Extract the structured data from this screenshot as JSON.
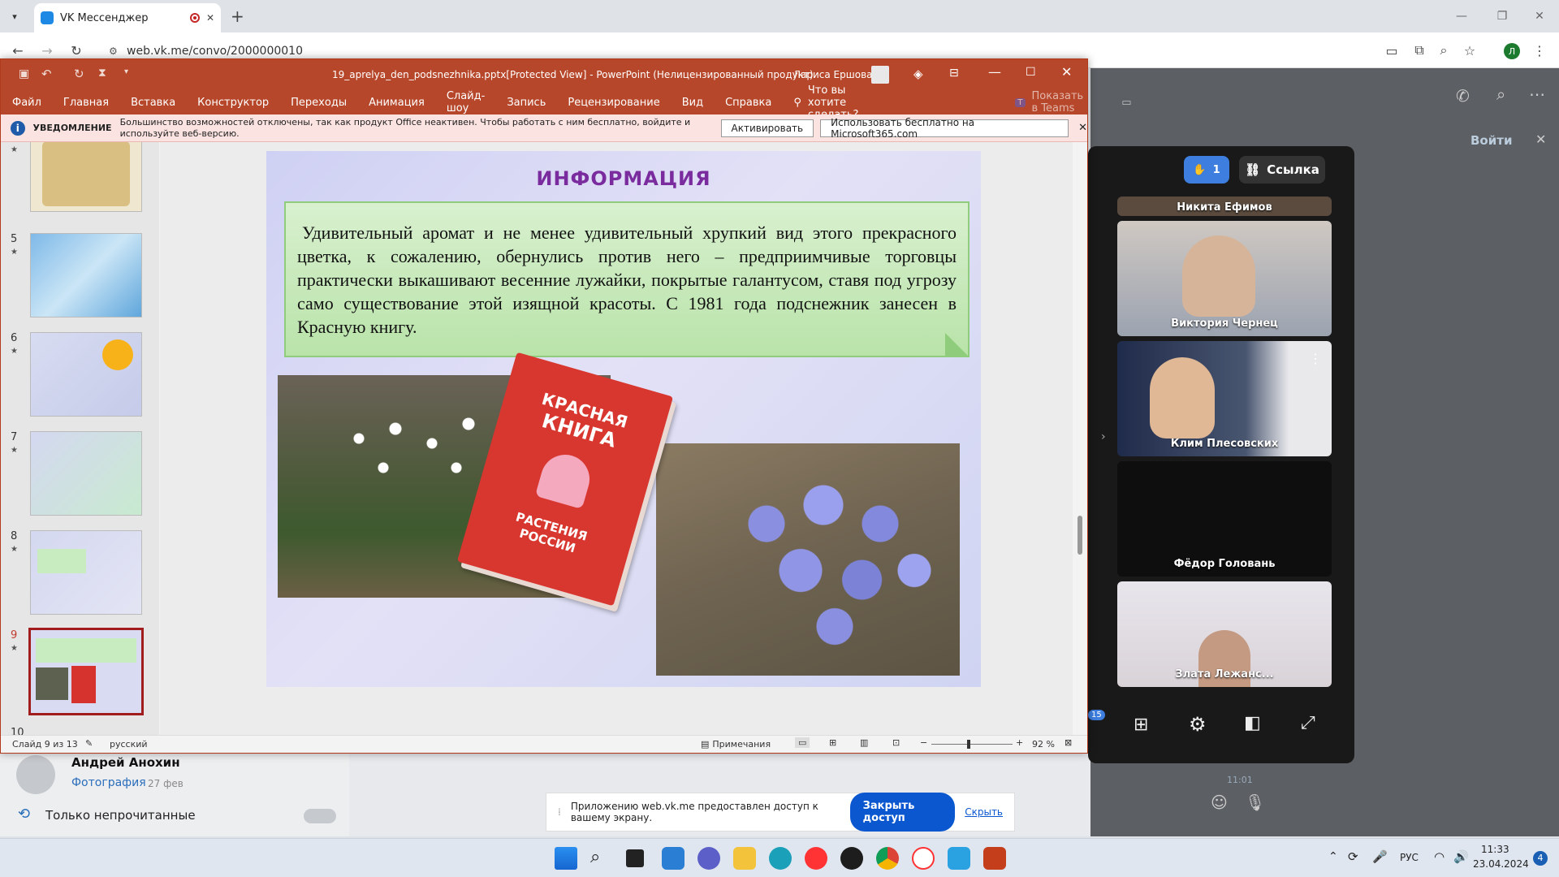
{
  "browser": {
    "tab_title": "VK Мессенджер",
    "tab_close": "✕",
    "new_tab": "+",
    "url": "web.vk.me/convo/2000000010"
  },
  "vk": {
    "login": "Войти",
    "chat_name": "Андрей Анохин",
    "chat_preview": "Фотография",
    "chat_date": "27 фев",
    "unread_only": "Только непрочитанные",
    "msg_time": "11:01"
  },
  "ppt": {
    "title": "19_aprelya_den_podsnezhnika.pptx[Protected View] - PowerPoint (Нелицензированный продукт)",
    "user": "Лариса Ершова",
    "menu": [
      "Файл",
      "Главная",
      "Вставка",
      "Конструктор",
      "Переходы",
      "Анимация",
      "Слайд-шоу",
      "Запись",
      "Рецензирование",
      "Вид",
      "Справка"
    ],
    "tell_me": "Что вы хотите сделать?",
    "teams": "Показать в Teams",
    "notice_label": "УВЕДОМЛЕНИЕ",
    "notice_text": "Большинство возможностей отключены, так как продукт Office неактивен. Чтобы работать с ним бесплатно, войдите и используйте веб-версию.",
    "btn_activate": "Активировать",
    "btn_free": "Использовать бесплатно на Microsoft365.com",
    "thumbs": [
      {
        "num": "5",
        "star": "★"
      },
      {
        "num": "6",
        "star": "★"
      },
      {
        "num": "7",
        "star": "★"
      },
      {
        "num": "8",
        "star": "★"
      },
      {
        "num": "9",
        "star": "★"
      },
      {
        "num": "10",
        "star": ""
      }
    ],
    "status": {
      "slide": "Слайд 9 из 13",
      "lang": "русский",
      "notes": "Примечания",
      "zoom": "92 %"
    }
  },
  "slide": {
    "title": "ИНФОРМАЦИЯ",
    "text": "Удивительный аромат и не менее удивительный хрупкий вид этого прекрасного цветка, к сожалению, обернулись против него – предприимчивые торговцы практически выкашивают весенние лужайки, покрытые галантусом, ставя под угрозу само существование этой изящной красоты. С 1981 года подснежник занесен в Красную книгу.",
    "book_line1": "КРАСНАЯ",
    "book_line2": "КНИГА",
    "book_line3": "РАСТЕНИЯ",
    "book_line4": "РОССИИ"
  },
  "call": {
    "hand_count": "1",
    "link_label": "Ссылка",
    "participants": [
      "Никита Ефимов",
      "Виктория Чернец",
      "Клим Плесовских",
      "Фёдор Головань",
      "Злата Лежанс..."
    ],
    "badge": "15"
  },
  "share": {
    "text": "Приложению web.vk.me предоставлен доступ к вашему экрану.",
    "stop": "Закрыть доступ",
    "hide": "Скрыть"
  },
  "taskbar": {
    "lang": "РУС",
    "time": "11:33",
    "date": "23.04.2024",
    "notif": "4"
  }
}
